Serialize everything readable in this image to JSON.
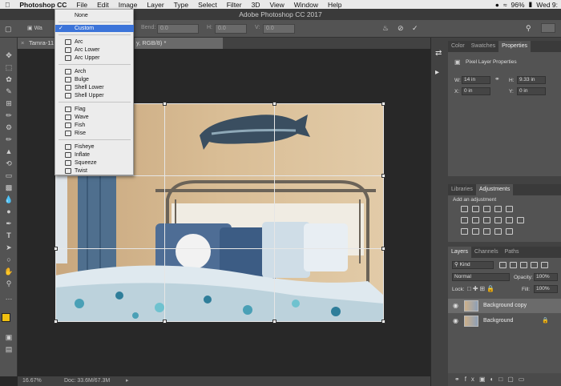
{
  "menubar": {
    "app": "Photoshop CC",
    "items": [
      "File",
      "Edit",
      "Image",
      "Layer",
      "Type",
      "Select",
      "Filter",
      "3D",
      "View",
      "Window",
      "Help"
    ],
    "battery": "96%",
    "clock": "Wed 9:"
  },
  "window": {
    "title": "Adobe Photoshop CC 2017"
  },
  "options": {
    "warp_label": "Wa",
    "bend_label": "Bend:",
    "bend_value": "0.0",
    "h_label": "H:",
    "h_value": "0.0",
    "v_label": "V:",
    "v_value": "0.0"
  },
  "document": {
    "tab_left": "Tamra-11",
    "tab_right": "y, RGB/8) *"
  },
  "status": {
    "zoom": "16.67%",
    "doc": "Doc: 33.6M/67.3M"
  },
  "warp_menu": {
    "none": "None",
    "custom": "Custom",
    "group1": [
      "Arc",
      "Arc Lower",
      "Arc Upper"
    ],
    "group2": [
      "Arch",
      "Bulge",
      "Shell Lower",
      "Shell Upper"
    ],
    "group3": [
      "Flag",
      "Wave",
      "Fish",
      "Rise"
    ],
    "group4": [
      "Fisheye",
      "Inflate",
      "Squeeze",
      "Twist"
    ]
  },
  "panels": {
    "top_tabs": [
      "Color",
      "Swatches",
      "Properties"
    ],
    "properties": {
      "title": "Pixel Layer Properties",
      "w_label": "W:",
      "w_value": "14 in",
      "h_label": "H:",
      "h_value": "9.33 in",
      "x_label": "X:",
      "x_value": "0 in",
      "y_label": "Y:",
      "y_value": "0 in"
    },
    "mid_tabs": [
      "Libraries",
      "Adjustments"
    ],
    "adjustments_title": "Add an adjustment",
    "layers_tabs": [
      "Layers",
      "Channels",
      "Paths"
    ],
    "kind": "Kind",
    "blend_mode": "Normal",
    "opacity_label": "Opacity:",
    "opacity": "100%",
    "lock_label": "Lock:",
    "fill_label": "Fill:",
    "fill": "100%",
    "layers": [
      "Background copy",
      "Background"
    ]
  }
}
